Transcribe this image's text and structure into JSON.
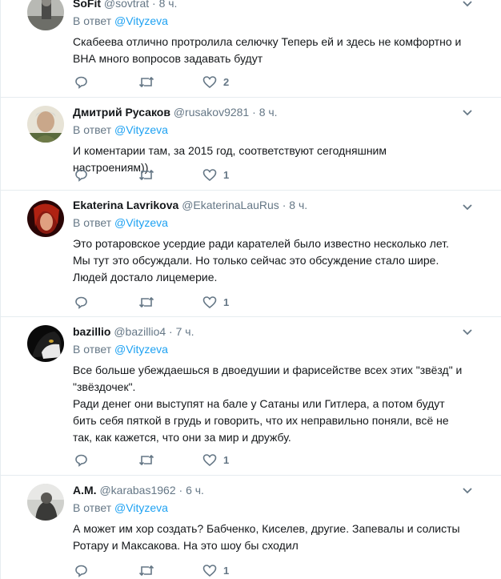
{
  "reply_prefix": "В ответ",
  "reply_mention": "@Vityzeva",
  "tweets": [
    {
      "name": "SoFit",
      "handle": "@sovtrat",
      "time": "8 ч.",
      "text": "Скабеева отлично протролила селючку Теперь ей и здесь не комфортно и ВНА много вопросов задавать будут",
      "likes": "2"
    },
    {
      "name": "Дмитрий Русаков",
      "handle": "@rusakov9281",
      "time": "8 ч.",
      "text": "И коментарии там, за 2015 год, соответствуют сегодняшним настроениям))",
      "likes": "1"
    },
    {
      "name": "Ekaterina Lavrikova",
      "handle": "@EkaterinaLauRus",
      "time": "8 ч.",
      "text": "Это ротаровское усердие ради карателей было известно несколько лет. Мы тут это обсуждали. Но только сейчас это обсуждение стало шире. Людей достало лицемерие.",
      "likes": "1"
    },
    {
      "name": "bazillio",
      "handle": "@bazillio4",
      "time": "7 ч.",
      "text": "Все больше убеждаешься в двоедушии и фарисействе всех этих \"звёзд\" и \"звёздочек\".",
      "text2": "Ради денег они выступят на бале у Сатаны или Гитлера, а потом будут бить себя пяткой в грудь и говорить, что их неправильно поняли, всё не так, как кажется, что они за мир и дружбу.",
      "likes": "1"
    },
    {
      "name": "A.M.",
      "handle": "@karabas1962",
      "time": "6 ч.",
      "text": "А может им хор создать? Бабченко, Киселев, другие. Запевалы и солисты Ротару и Максакова. На это шоу бы сходил",
      "likes": "1"
    }
  ]
}
